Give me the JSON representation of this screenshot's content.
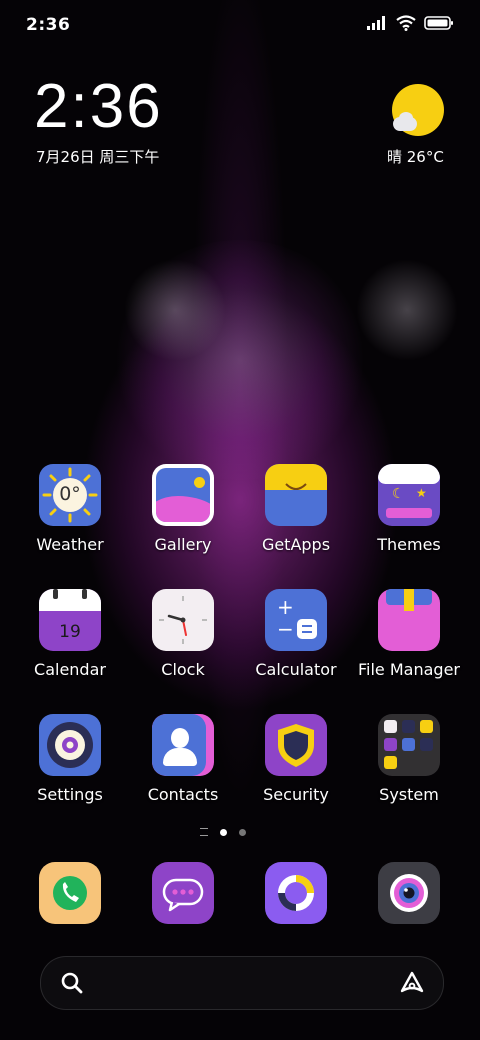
{
  "status_bar": {
    "time": "2:36"
  },
  "clock_widget": {
    "time": "2:36",
    "date": "7月26日 周三下午"
  },
  "weather_widget": {
    "text": "晴 26°C"
  },
  "apps": [
    {
      "label": "Weather",
      "icon": "weather-icon",
      "badge": "0°"
    },
    {
      "label": "Gallery",
      "icon": "gallery-icon"
    },
    {
      "label": "GetApps",
      "icon": "getapps-icon"
    },
    {
      "label": "Themes",
      "icon": "themes-icon"
    },
    {
      "label": "Calendar",
      "icon": "calendar-icon",
      "badge": "19"
    },
    {
      "label": "Clock",
      "icon": "clock-icon"
    },
    {
      "label": "Calculator",
      "icon": "calculator-icon"
    },
    {
      "label": "File Manager",
      "icon": "file-manager-icon"
    },
    {
      "label": "Settings",
      "icon": "settings-icon"
    },
    {
      "label": "Contacts",
      "icon": "contacts-icon"
    },
    {
      "label": "Security",
      "icon": "security-icon"
    },
    {
      "label": "System",
      "icon": "system-folder-icon"
    }
  ],
  "dock": [
    "phone-icon",
    "messages-icon",
    "browser-icon",
    "camera-icon"
  ],
  "page_indicator": {
    "pages": 2,
    "current": 1
  },
  "colors": {
    "accent_purple": "#8e44c8",
    "blue": "#4d71d6",
    "yellow": "#f7cf12",
    "pink": "#e35ed6"
  }
}
